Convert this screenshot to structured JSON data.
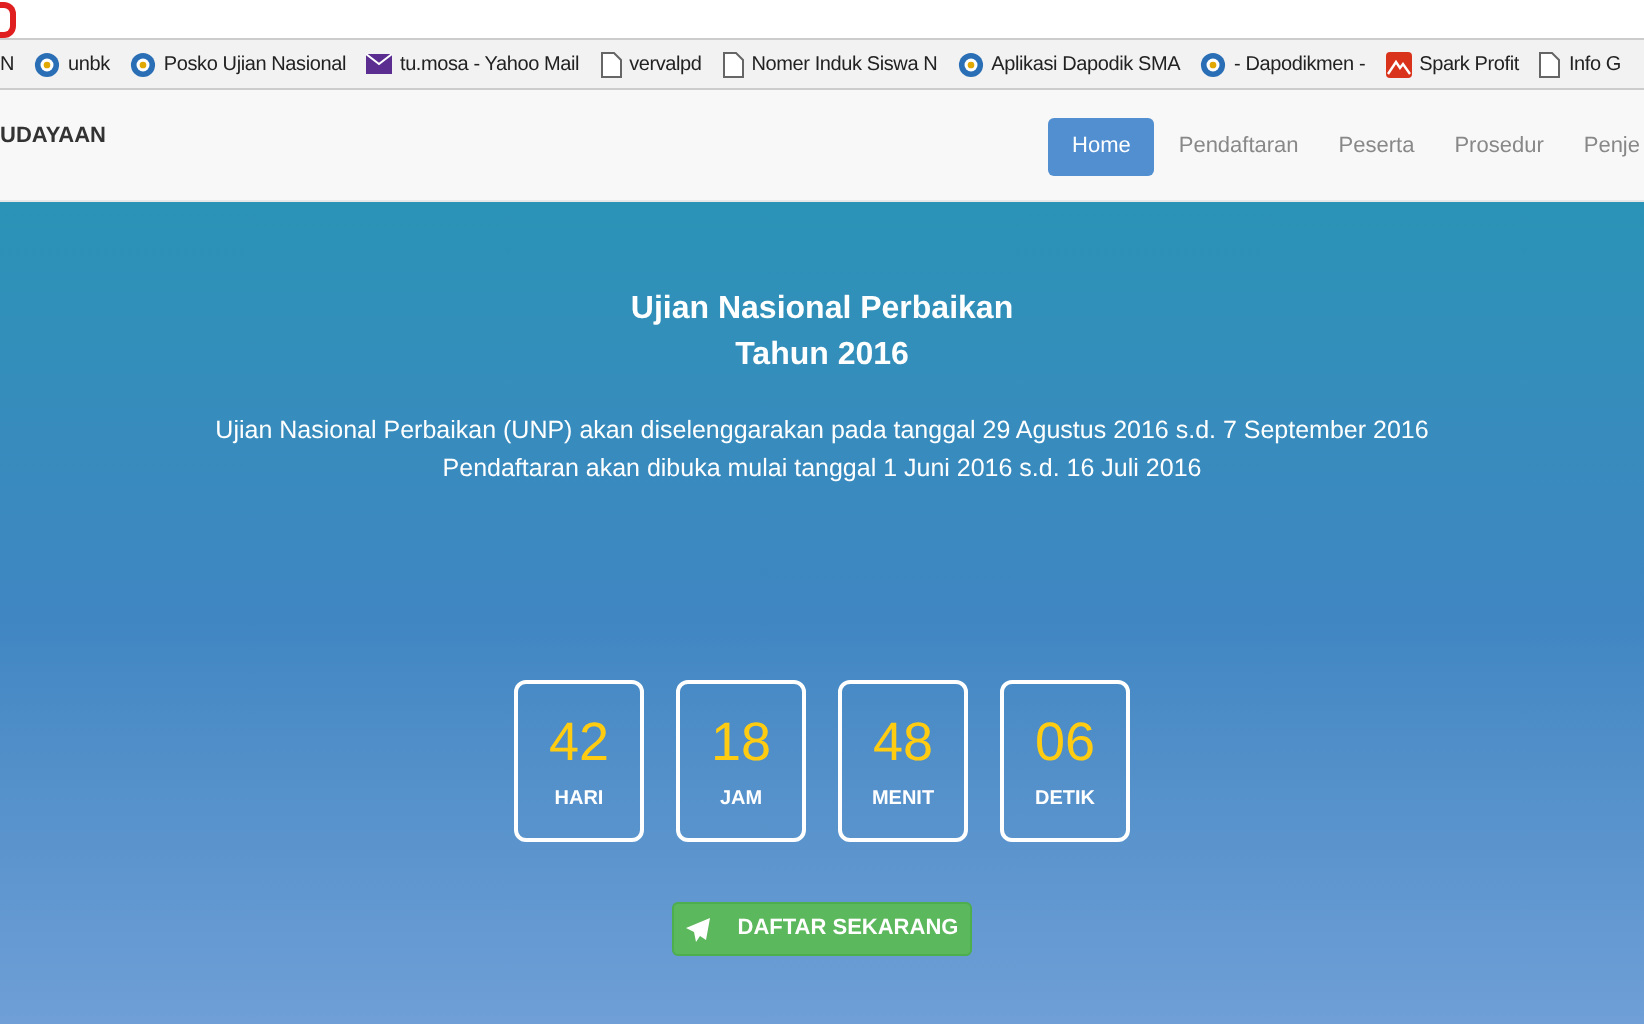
{
  "bookmarks_bar": [
    {
      "label": "N",
      "kind": "none"
    },
    {
      "label": "unbk",
      "kind": "globe"
    },
    {
      "label": "Posko Ujian Nasional",
      "kind": "globe"
    },
    {
      "label": "tu.mosa - Yahoo Mail",
      "kind": "mail"
    },
    {
      "label": "vervalpd",
      "kind": "page"
    },
    {
      "label": "Nomer Induk Siswa N",
      "kind": "page"
    },
    {
      "label": "Aplikasi Dapodik SMA",
      "kind": "globe"
    },
    {
      "label": "- Dapodikmen -",
      "kind": "globe"
    },
    {
      "label": "Spark Profit",
      "kind": "spark"
    },
    {
      "label": "Info G",
      "kind": "page"
    }
  ],
  "navbar": {
    "brand": "UDAYAAN",
    "items": [
      {
        "label": "Home",
        "selected": true
      },
      {
        "label": "Pendaftaran",
        "selected": false
      },
      {
        "label": "Peserta",
        "selected": false
      },
      {
        "label": "Prosedur",
        "selected": false
      },
      {
        "label": "Penje",
        "selected": false
      }
    ]
  },
  "hero": {
    "title_lines": [
      "Ujian Nasional Perbaikan",
      "Tahun 2016"
    ],
    "description_lines": [
      "Ujian Nasional Perbaikan (UNP) akan diselenggarakan pada tanggal 29 Agustus 2016 s.d. 7 September 2016",
      "Pendaftaran akan dibuka mulai tanggal 1 Juni 2016 s.d. 16 Juli 2016"
    ],
    "countdown": [
      {
        "value": "42",
        "unit": "HARI"
      },
      {
        "value": "18",
        "unit": "JAM"
      },
      {
        "value": "48",
        "unit": "MENIT"
      },
      {
        "value": "06",
        "unit": "DETIK"
      }
    ],
    "button": "DAFTAR SEKARANG"
  }
}
